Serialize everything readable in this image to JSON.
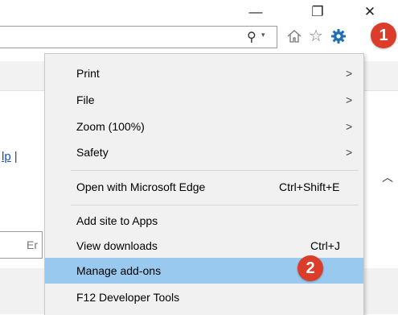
{
  "window_controls": {
    "minimize": "—",
    "restore": "❐",
    "close": "✕"
  },
  "toolbar": {
    "search_icon": "search-icon",
    "dropdown_glyph": "▾",
    "icons": [
      "home-icon",
      "star-icon",
      "gear-icon"
    ]
  },
  "badges": {
    "first": "1",
    "second": "2"
  },
  "background_page": {
    "help_link": "lp",
    "separator": "|",
    "input_text": "Er"
  },
  "menu": {
    "items": [
      {
        "label": "Print",
        "submenu": ">"
      },
      {
        "label": "File",
        "submenu": ">"
      },
      {
        "label": "Zoom (100%)",
        "submenu": ">"
      },
      {
        "label": "Safety",
        "submenu": ">"
      },
      {
        "label": "Open with Microsoft Edge",
        "shortcut": "Ctrl+Shift+E"
      },
      {
        "label": "Add site to Apps"
      },
      {
        "label": "View downloads",
        "shortcut": "Ctrl+J"
      },
      {
        "label": "Manage add-ons",
        "highlighted": true
      },
      {
        "label": "F12 Developer Tools"
      }
    ]
  },
  "colors": {
    "highlight": "#99c9ef",
    "badge": "#dc3c2a",
    "gear": "#1f6fb3",
    "link": "#1a4fb5"
  }
}
